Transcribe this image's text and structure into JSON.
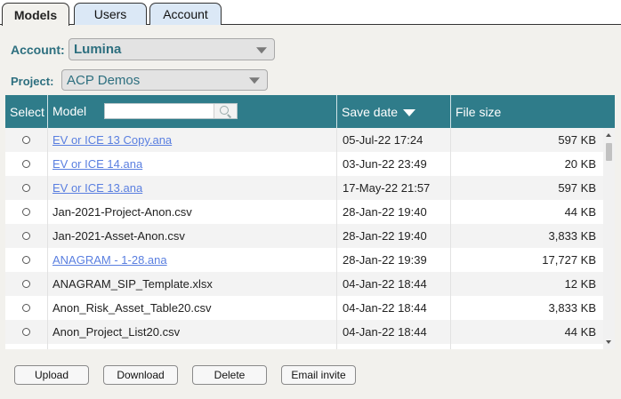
{
  "tabs": [
    {
      "label": "Models",
      "active": true
    },
    {
      "label": "Users",
      "active": false
    },
    {
      "label": "Account",
      "active": false
    }
  ],
  "account": {
    "label": "Account:",
    "value": "Lumina"
  },
  "project": {
    "label": "Project:",
    "value": "ACP Demos"
  },
  "table": {
    "headers": {
      "select": "Select",
      "model": "Model",
      "save_date": "Save date",
      "file_size": "File size"
    },
    "search": {
      "value": "",
      "placeholder": ""
    },
    "sort": {
      "column": "Save date",
      "direction": "descending"
    },
    "rows": [
      {
        "model": "EV or ICE 13 Copy.ana",
        "link": true,
        "date": "05-Jul-22 17:24",
        "size": "597 KB"
      },
      {
        "model": "EV or ICE 14.ana",
        "link": true,
        "date": "03-Jun-22 23:49",
        "size": "20 KB"
      },
      {
        "model": "EV or ICE 13.ana",
        "link": true,
        "date": "17-May-22 21:57",
        "size": "597 KB"
      },
      {
        "model": "Jan-2021-Project-Anon.csv",
        "link": false,
        "date": "28-Jan-22 19:40",
        "size": "44 KB"
      },
      {
        "model": "Jan-2021-Asset-Anon.csv",
        "link": false,
        "date": "28-Jan-22 19:40",
        "size": "3,833 KB"
      },
      {
        "model": "ANAGRAM - 1-28.ana",
        "link": true,
        "date": "28-Jan-22 19:39",
        "size": "17,727 KB"
      },
      {
        "model": "ANAGRAM_SIP_Template.xlsx",
        "link": false,
        "date": "04-Jan-22 18:44",
        "size": "12 KB"
      },
      {
        "model": "Anon_Risk_Asset_Table20.csv",
        "link": false,
        "date": "04-Jan-22 18:44",
        "size": "3,833 KB"
      },
      {
        "model": "Anon_Project_List20.csv",
        "link": false,
        "date": "04-Jan-22 18:44",
        "size": "44 KB"
      },
      {
        "model": "",
        "link": false,
        "date": "",
        "size": ""
      }
    ]
  },
  "buttons": {
    "upload": "Upload",
    "download": "Download",
    "delete": "Delete",
    "email_invite": "Email invite"
  },
  "colors": {
    "header_bg": "#2f7c8a",
    "label_teal": "#2d6f7f",
    "link_blue": "#5a7fe0",
    "active_tab_bg": "#f2f1ed",
    "inactive_tab_bg": "#dbe8f6",
    "panel_bg": "#f2f1ed"
  },
  "icons": {
    "search": "magnifier-icon",
    "sort": "triangle-down-icon",
    "dropdown": "chevron-down-icon"
  }
}
